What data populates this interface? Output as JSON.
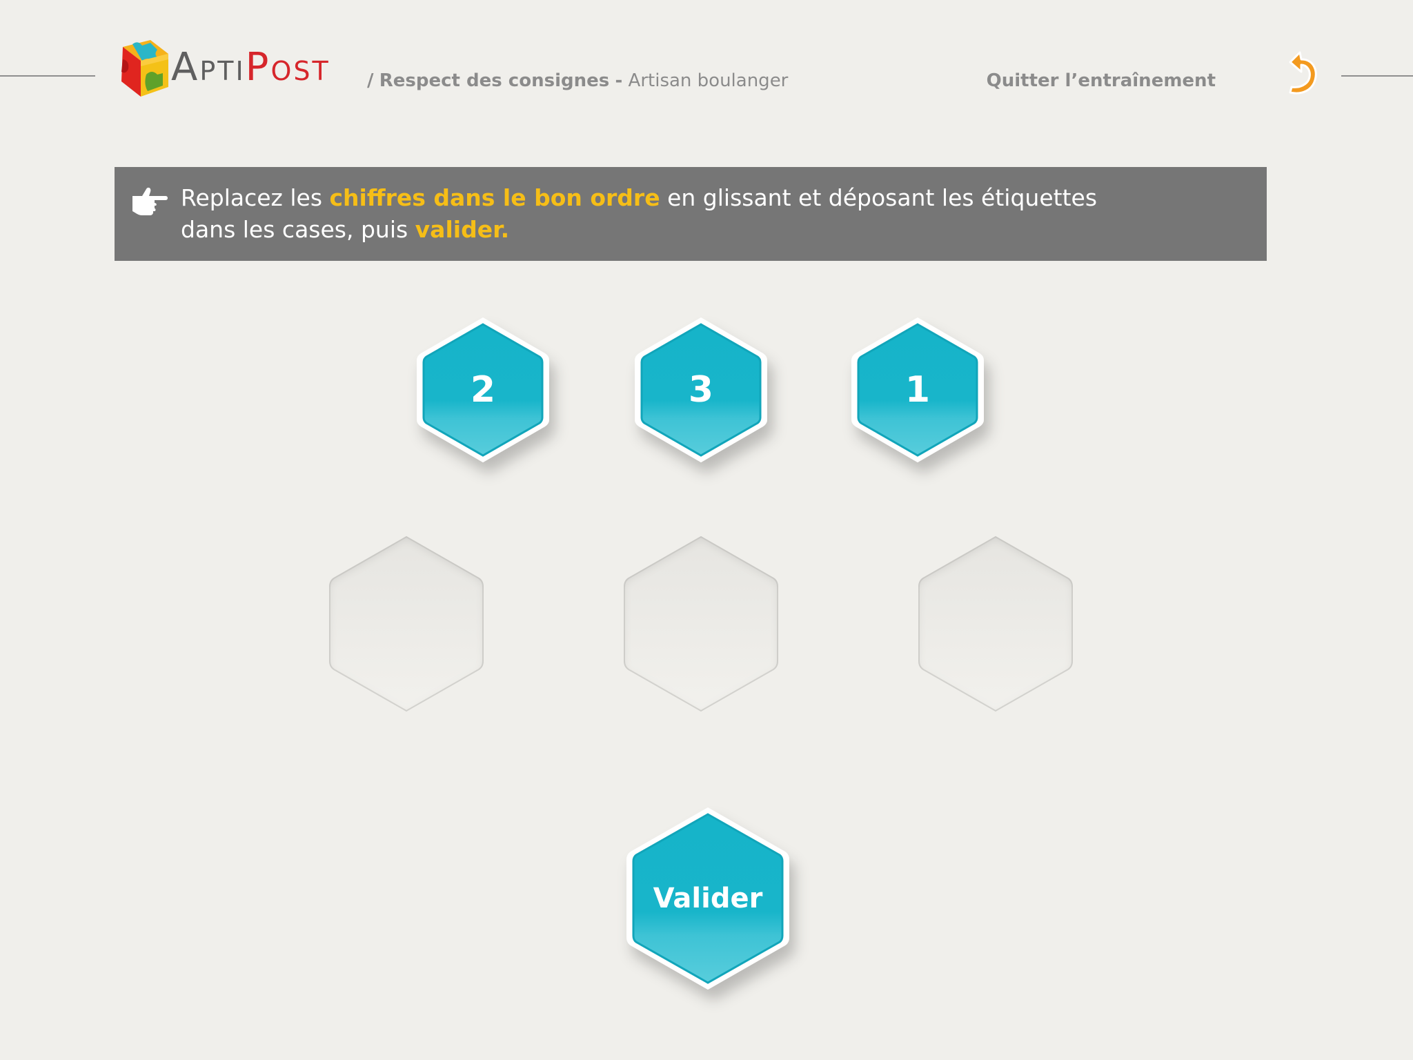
{
  "header": {
    "logo": {
      "part1_cap": "A",
      "part1_rest": "PTI",
      "part2_cap": "P",
      "part2_rest": "OST"
    },
    "breadcrumb": {
      "separator": "/",
      "section": "Respect des consignes",
      "dash": "-",
      "job": "Artisan boulanger"
    },
    "quit_label": "Quitter l’entraînement",
    "quit_icon": "undo-arrow-icon"
  },
  "instruction": {
    "icon": "pointing-hand-icon",
    "text_1": "Replacez les ",
    "highlight_1": "chiffres dans le bon ordre",
    "text_2": " en glissant et déposant les étiquettes",
    "text_3": "dans les cases, puis ",
    "highlight_2": "valider."
  },
  "tiles": [
    {
      "label": "2"
    },
    {
      "label": "3"
    },
    {
      "label": "1"
    }
  ],
  "slots": [
    {
      "value": ""
    },
    {
      "value": ""
    },
    {
      "value": ""
    }
  ],
  "validate_label": "Valider",
  "colors": {
    "background": "#f0efeb",
    "banner": "#767676",
    "highlight": "#f6be17",
    "tile_teal": "#16b4c9",
    "logo_red": "#d6262b"
  }
}
